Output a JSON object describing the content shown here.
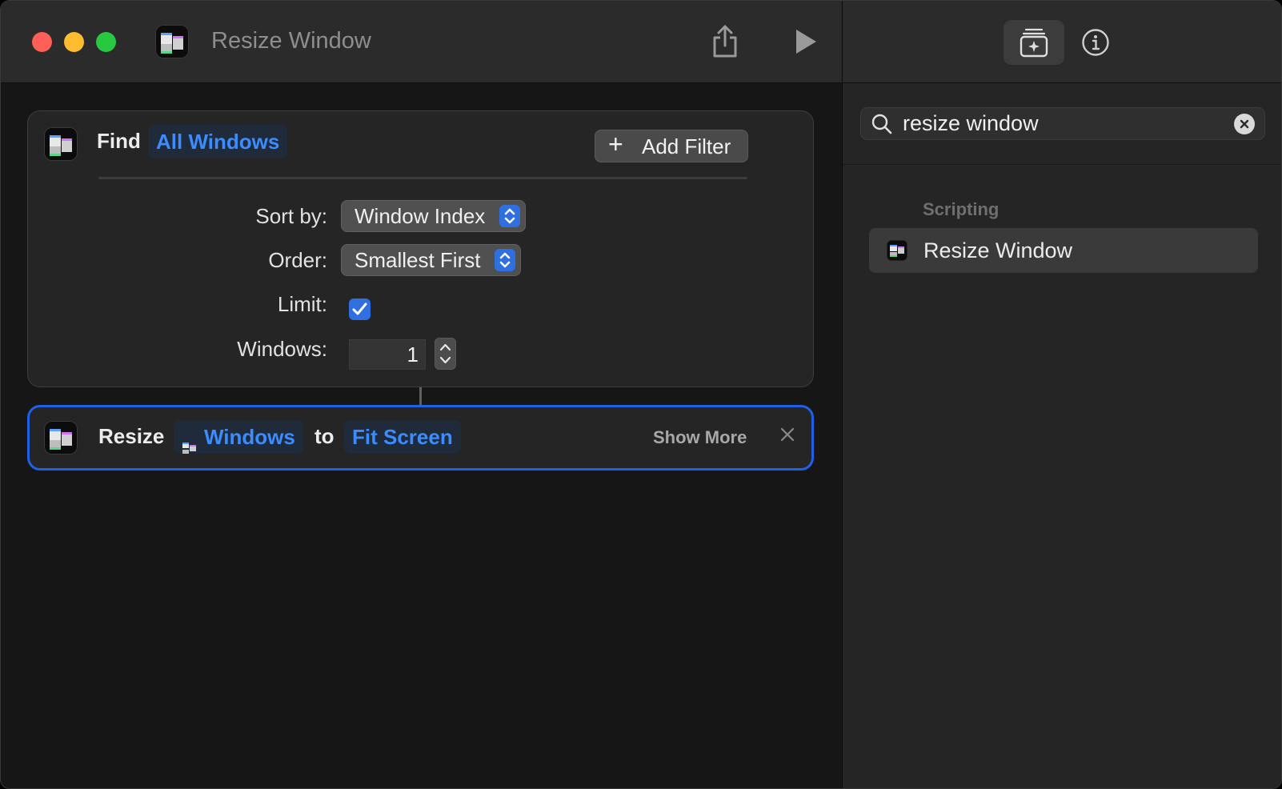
{
  "window": {
    "title": "Resize Window"
  },
  "toolbar": {
    "share_icon": "share-icon",
    "run_icon": "play-icon"
  },
  "find_action": {
    "verb": "Find",
    "subject": "All Windows",
    "add_filter_label": "Add Filter",
    "params": {
      "sort_by_label": "Sort by:",
      "sort_by_value": "Window Index",
      "order_label": "Order:",
      "order_value": "Smallest First",
      "limit_label": "Limit:",
      "limit_checked": true,
      "windows_label": "Windows:",
      "windows_value": "1"
    }
  },
  "resize_action": {
    "verb": "Resize",
    "target": "Windows",
    "connector": "to",
    "mode": "Fit Screen",
    "show_more_label": "Show More"
  },
  "library": {
    "search_value": "resize window",
    "section_title": "Scripting",
    "results": [
      {
        "label": "Resize Window"
      }
    ]
  },
  "colors": {
    "accent": "#2f6fe0",
    "token_text": "#3b8cff",
    "selected_border": "#2060e6",
    "close": "#fe5f57",
    "minimize": "#febc2e",
    "maximize": "#28c840"
  }
}
